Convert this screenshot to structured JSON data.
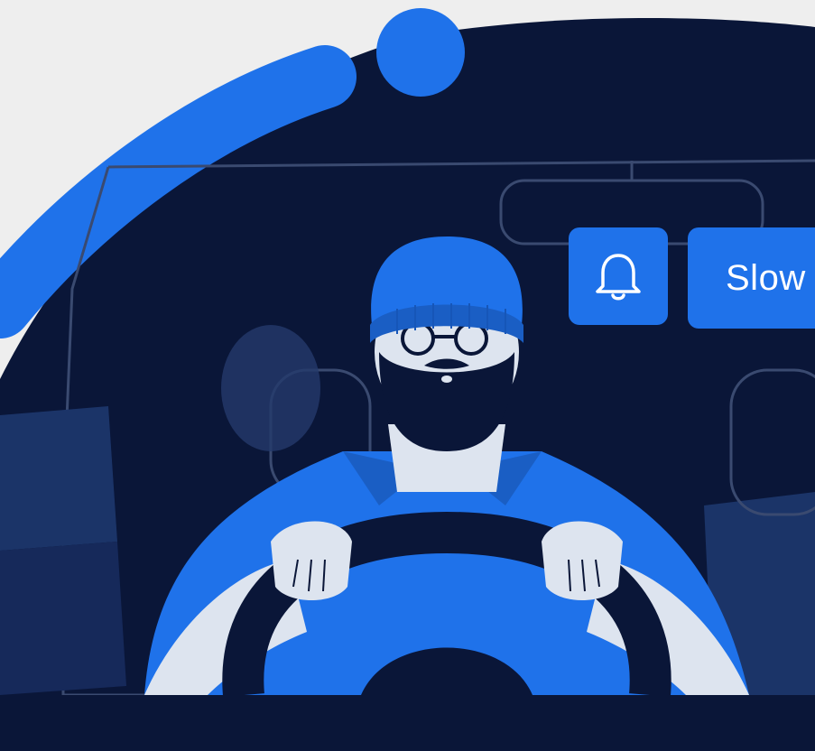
{
  "illustration": {
    "subject": "bearded-driver-icon",
    "colors": {
      "background": "#eeeeee",
      "night": "#0a1638",
      "blue": "#1f72ea",
      "skin": "#dde4ef"
    }
  },
  "alert": {
    "icon": "bell-icon",
    "text": "Slow"
  }
}
